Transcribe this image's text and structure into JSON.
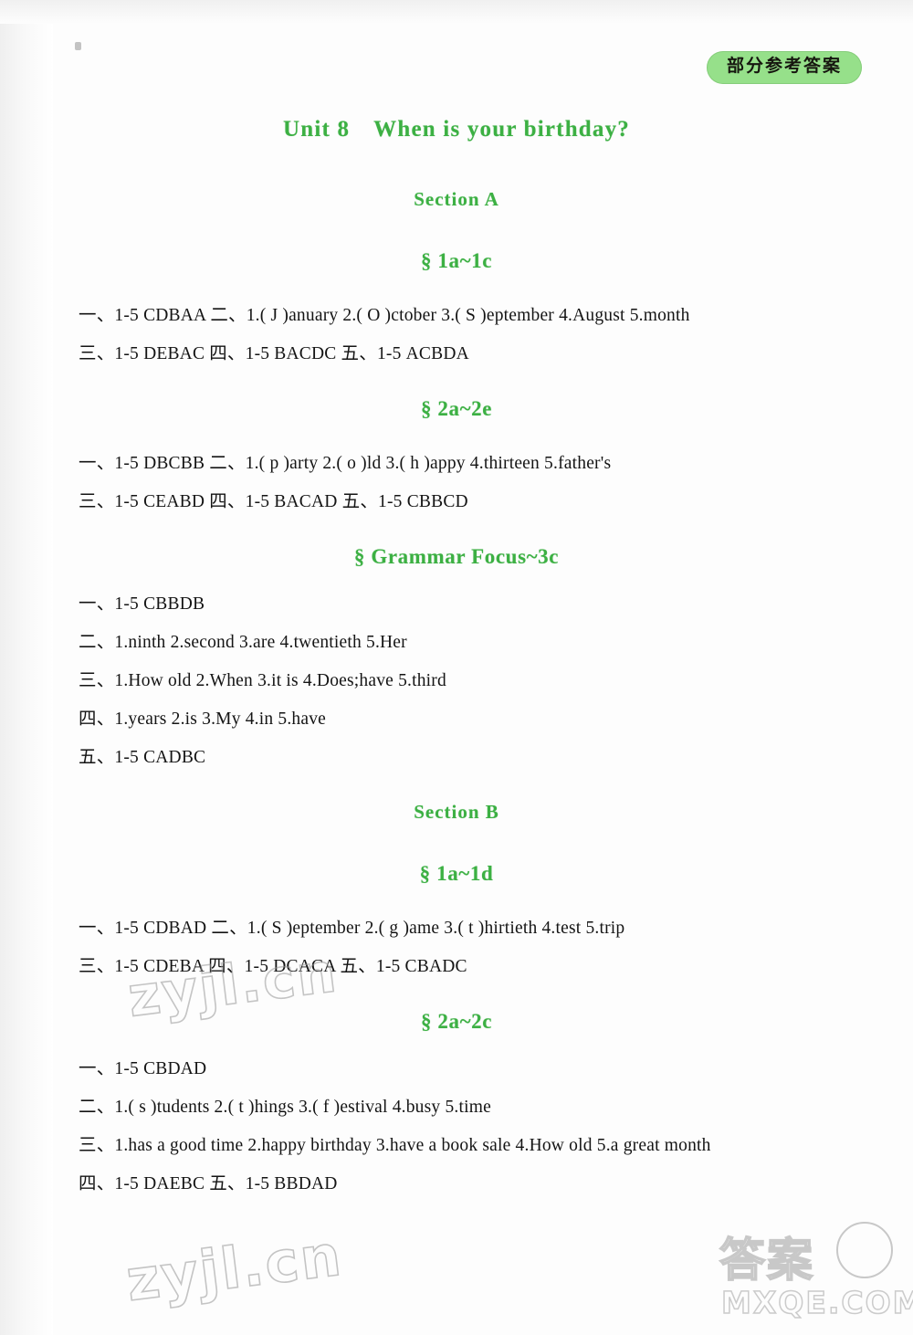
{
  "header": {
    "badge_label": "部分参考答案"
  },
  "unit": {
    "number_label": "Unit 8",
    "title": "When is your birthday?"
  },
  "sections": [
    {
      "name": "Section A",
      "subsections": [
        {
          "heading": "§ 1a~1c",
          "lines": [
            "一、1-5 CDBAA    二、1.( J )anuary    2.( O )ctober    3.( S )eptember    4.August    5.month",
            "三、1-5 DEBAC    四、1-5 BACDC    五、1-5 ACBDA"
          ]
        },
        {
          "heading": "§ 2a~2e",
          "lines": [
            "一、1-5 DBCBB    二、1.( p )arty    2.( o )ld    3.( h )appy    4.thirteen    5.father's",
            "三、1-5 CEABD    四、1-5 BACAD    五、1-5 CBBCD"
          ]
        },
        {
          "heading": "§ Grammar Focus~3c",
          "lines": [
            "一、1-5 CBBDB",
            "二、1.ninth    2.second    3.are    4.twentieth    5.Her",
            "三、1.How old    2.When    3.it is    4.Does;have    5.third",
            "四、1.years    2.is    3.My    4.in    5.have",
            "五、1-5 CADBC"
          ]
        }
      ]
    },
    {
      "name": "Section B",
      "subsections": [
        {
          "heading": "§ 1a~1d",
          "lines": [
            "一、1-5 CDBAD    二、1.( S )eptember    2.( g )ame    3.( t )hirtieth    4.test    5.trip",
            "三、1-5 CDEBA    四、1-5 DCACA    五、1-5 CBADC"
          ]
        },
        {
          "heading": "§ 2a~2c",
          "lines": [
            "一、1-5 CBDAD",
            "二、1.( s )tudents    2.( t )hings    3.( f )estival    4.busy    5.time",
            "三、1.has a good time    2.happy birthday    3.have a book sale    4.How old    5.a great month",
            "四、1-5 DAEBC    五、1-5 BBDAD"
          ]
        }
      ]
    }
  ],
  "watermarks": {
    "site_mid": "zyjl.cn",
    "site_bottom": "zyjl.cn",
    "badge_cn": "答案",
    "badge_domain": "MXQE.COM"
  },
  "colors": {
    "heading_green": "#3cb043",
    "badge_green": "#96e08a",
    "body_text": "#141414"
  }
}
